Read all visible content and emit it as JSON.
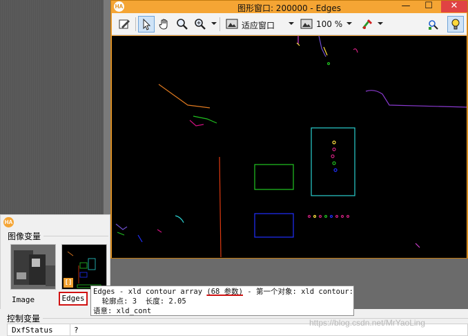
{
  "graphics_window": {
    "logo": "HA",
    "title": "图形窗口: 200000 - Edges",
    "minimize_label": "—",
    "maximize_label": "☐",
    "close_label": "✕",
    "toolbar": {
      "fit_label": "适应窗口",
      "zoom_label": "100 %"
    }
  },
  "variables": {
    "logo": "HA",
    "image_section_title": "图像变量",
    "items": [
      {
        "label": "Image"
      },
      {
        "label": "Edges",
        "badge": "[]"
      }
    ],
    "control_section_title": "控制变量",
    "control_rows": [
      {
        "name": "DxfStatus",
        "value": "?"
      }
    ]
  },
  "tooltip": {
    "line1_prefix": "Edges - xld contour array ",
    "line1_count": "(68 参数)",
    "line1_suffix": " - 第一个对象: xld contour:",
    "line2": "  轮廓点: 3  长度: 2.05",
    "line3": "语意: xld_cont"
  },
  "watermark": "https://blog.csdn.net/MrYaoLing",
  "colors": {
    "window_title_bg": "#f5a534",
    "close_bg": "#e04343",
    "highlight_red": "#d01010"
  }
}
